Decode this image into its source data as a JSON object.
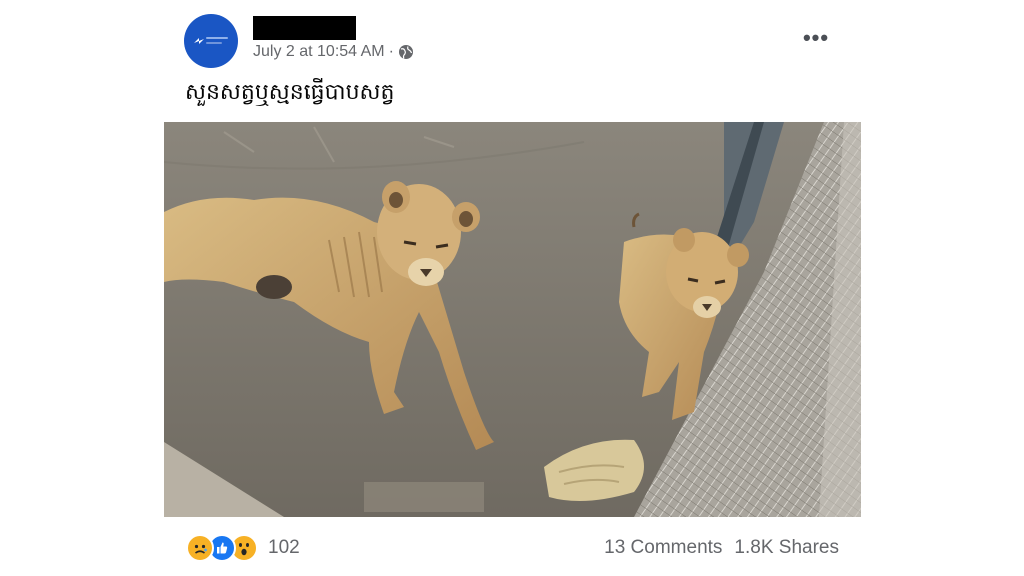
{
  "post": {
    "timestamp": "July 2 at 10:54 AM",
    "separator": "·",
    "caption": "សួនសត្វឬស្មនធ្វើបាបសត្វ",
    "more_label": "•••"
  },
  "icons": {
    "avatar": "page-logo-icon",
    "audience": "globe-icon",
    "more": "more-options-icon",
    "reactions": [
      "sad-reaction-icon",
      "like-reaction-icon",
      "wow-reaction-icon"
    ]
  },
  "colors": {
    "avatar_bg": "#1a56c4",
    "meta_text": "#65676b",
    "like_blue": "#1877f2",
    "reaction_yellow": "#f7b125"
  },
  "photo": {
    "subject": "two emaciated lions lying on concrete beside metal fence"
  },
  "footer": {
    "reaction_count": "102",
    "comments": "13 Comments",
    "shares": "1.8K Shares"
  }
}
